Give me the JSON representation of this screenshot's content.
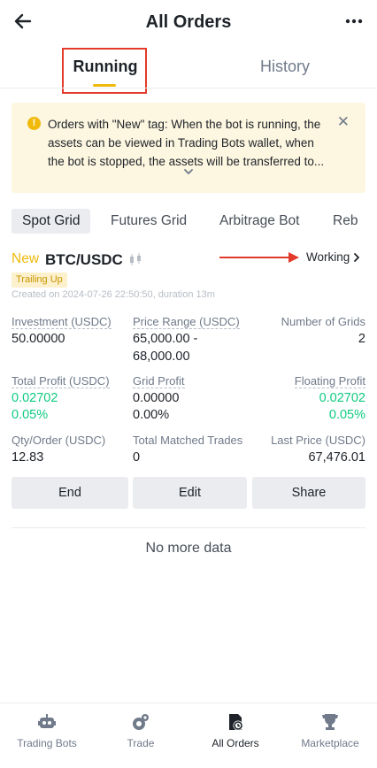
{
  "header": {
    "title": "All Orders",
    "back_icon": "arrow-left-icon",
    "more_icon": "more-dots-icon"
  },
  "tabs": [
    {
      "label": "Running",
      "active": true
    },
    {
      "label": "History",
      "active": false
    }
  ],
  "notice": {
    "text": "Orders with \"New\" tag: When the bot is running, the assets can be viewed in Trading Bots wallet, when the bot is stopped, the assets will be transferred to...",
    "icon": "warning-circle-icon"
  },
  "bot_tabs": [
    "Spot Grid",
    "Futures Grid",
    "Arbitrage Bot",
    "Reb"
  ],
  "order": {
    "new_tag": "New",
    "pair": "BTC/USDC",
    "status": "Working",
    "badge": "Trailing Up",
    "created": "Created on 2024-07-26 22:50:50, duration 13m",
    "fields": {
      "investment_label": "Investment (USDC)",
      "investment_value": "50.00000",
      "price_range_label": "Price Range (USDC)",
      "price_range_value_1": "65,000.00 -",
      "price_range_value_2": "68,000.00",
      "grids_label": "Number of Grids",
      "grids_value": "2",
      "total_profit_label": "Total Profit (USDC)",
      "total_profit_value": "0.02702",
      "total_profit_pct": "0.05%",
      "grid_profit_label": "Grid Profit",
      "grid_profit_value": "0.00000",
      "grid_profit_pct": "0.00%",
      "floating_profit_label": "Floating Profit",
      "floating_profit_value": "0.02702",
      "floating_profit_pct": "0.05%",
      "qty_label": "Qty/Order (USDC)",
      "qty_value": "12.83",
      "matched_label": "Total Matched Trades",
      "matched_value": "0",
      "last_price_label": "Last Price (USDC)",
      "last_price_value": "67,476.01"
    },
    "buttons": {
      "end": "End",
      "edit": "Edit",
      "share": "Share"
    }
  },
  "no_more": "No more data",
  "bottom_nav": [
    {
      "label": "Trading Bots",
      "icon": "robot-icon",
      "active": false
    },
    {
      "label": "Trade",
      "icon": "trade-icon",
      "active": false
    },
    {
      "label": "All Orders",
      "icon": "orders-icon",
      "active": true
    },
    {
      "label": "Marketplace",
      "icon": "trophy-icon",
      "active": false
    }
  ],
  "colors": {
    "accent": "#f0b90b",
    "positive": "#0ecb81",
    "annotation": "#e23b2b"
  }
}
